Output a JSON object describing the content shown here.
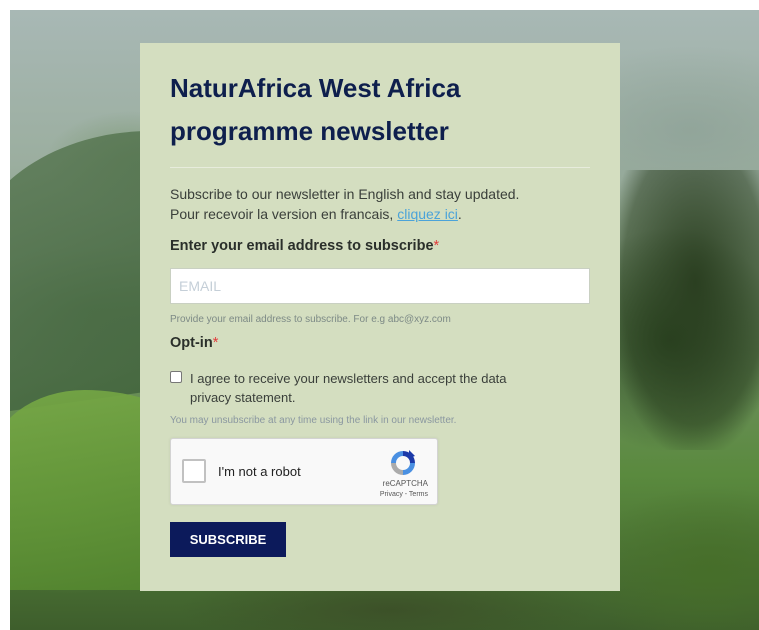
{
  "form": {
    "title": "NaturAfrica West Africa programme newsletter",
    "intro_line1": "Subscribe to our newsletter in English and stay updated.",
    "intro_line2_prefix": "Pour recevoir la version en francais, ",
    "intro_link": "cliquez ici",
    "intro_line2_suffix": ".",
    "email_label": "Enter your email address to subscribe",
    "required_marker": "*",
    "email_placeholder": "EMAIL",
    "email_value": "",
    "email_help": "Provide your email address to subscribe. For e.g abc@xyz.com",
    "optin_label": "Opt-in",
    "optin_text": "I agree to receive your newsletters and accept the data privacy statement.",
    "unsubscribe_note": "You may unsubscribe at any time using the link in our newsletter.",
    "subscribe_label": "SUBSCRIBE"
  },
  "captcha": {
    "label": "I'm not a robot",
    "brand": "reCAPTCHA",
    "links": "Privacy - Terms"
  },
  "colors": {
    "card_bg": "#d4dec0",
    "title": "#0e1f4d",
    "button_bg": "#0c1a5b",
    "link": "#4ba3d9",
    "required": "#e23b3b"
  }
}
